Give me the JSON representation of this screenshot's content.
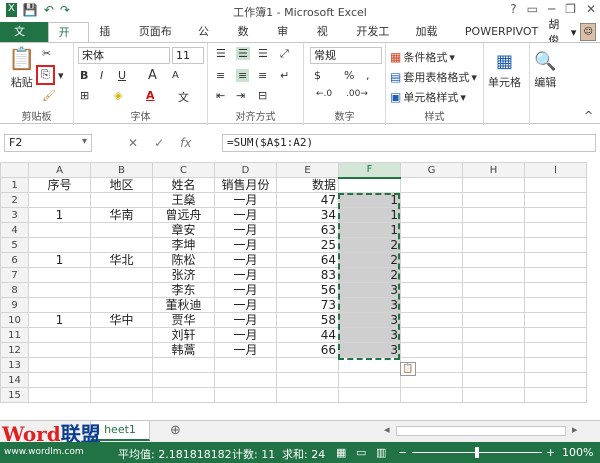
{
  "title_bar": {
    "title": "工作簿1 - Microsoft Excel",
    "qat": [
      "💾",
      "↶",
      "↷"
    ]
  },
  "tabs": [
    "文件",
    "开始",
    "插入",
    "页面布局",
    "公式",
    "数据",
    "审阅",
    "视图",
    "开发工具",
    "加载项",
    "POWERPIVOT"
  ],
  "user": "胡俊",
  "ribbon": {
    "clipboard": {
      "paste": "粘贴",
      "label": "剪贴板"
    },
    "font": {
      "name": "宋体",
      "size": "11",
      "label": "字体",
      "bold": "B",
      "italic": "I",
      "underline": "U",
      "grow": "A",
      "shrink": "A"
    },
    "alignment": {
      "label": "对齐方式"
    },
    "number": {
      "format": "常规",
      "label": "数字",
      "currency": "$",
      "percent": "%",
      "comma": ","
    },
    "styles": {
      "conditional": "条件格式",
      "table": "套用表格格式",
      "cell": "单元格样式",
      "label": "样式"
    },
    "cells": {
      "label": "单元格"
    },
    "editing": {
      "label": "编辑"
    }
  },
  "formula_bar": {
    "name_box": "F2",
    "formula": "=SUM($A$1:A2)",
    "cancel": "✕",
    "enter": "✓",
    "fx": "fx"
  },
  "columns": [
    "A",
    "B",
    "C",
    "D",
    "E",
    "F",
    "G",
    "H",
    "I"
  ],
  "rows": [
    [
      "1",
      "序号",
      "地区",
      "姓名",
      "销售月份",
      "数据",
      "",
      "",
      "",
      ""
    ],
    [
      "2",
      "",
      "",
      "王燊",
      "一月",
      "47",
      "1",
      "",
      "",
      ""
    ],
    [
      "3",
      "1",
      "华南",
      "曾远舟",
      "一月",
      "34",
      "1",
      "",
      "",
      ""
    ],
    [
      "4",
      "",
      "",
      "章安",
      "一月",
      "63",
      "1",
      "",
      "",
      ""
    ],
    [
      "5",
      "",
      "",
      "李坤",
      "一月",
      "25",
      "2",
      "",
      "",
      ""
    ],
    [
      "6",
      "1",
      "华北",
      "陈松",
      "一月",
      "64",
      "2",
      "",
      "",
      ""
    ],
    [
      "7",
      "",
      "",
      "张济",
      "一月",
      "83",
      "2",
      "",
      "",
      ""
    ],
    [
      "8",
      "",
      "",
      "李东",
      "一月",
      "56",
      "3",
      "",
      "",
      ""
    ],
    [
      "9",
      "",
      "",
      "董秋迪",
      "一月",
      "73",
      "3",
      "",
      "",
      ""
    ],
    [
      "10",
      "1",
      "华中",
      "贾华",
      "一月",
      "58",
      "3",
      "",
      "",
      ""
    ],
    [
      "11",
      "",
      "",
      "刘轩",
      "一月",
      "44",
      "3",
      "",
      "",
      ""
    ],
    [
      "12",
      "",
      "",
      "韩蒿",
      "一月",
      "66",
      "3",
      "",
      "",
      ""
    ],
    [
      "13",
      "",
      "",
      "",
      "",
      "",
      "",
      "",
      "",
      ""
    ],
    [
      "14",
      "",
      "",
      "",
      "",
      "",
      "",
      "",
      "",
      ""
    ],
    [
      "15",
      "",
      "",
      "",
      "",
      "",
      "",
      "",
      "",
      ""
    ]
  ],
  "sheet_tab": "heet1",
  "watermark": {
    "brand_word": "Word",
    "brand_cn": "联盟",
    "url": "www.wordlm.com"
  },
  "status": {
    "average": "平均值: 2.181818182",
    "count": "计数: 11",
    "sum": "求和: 24",
    "zoom": "100%"
  },
  "colors": {
    "accent": "#217346",
    "fill_selected": "#cfcfcf"
  }
}
